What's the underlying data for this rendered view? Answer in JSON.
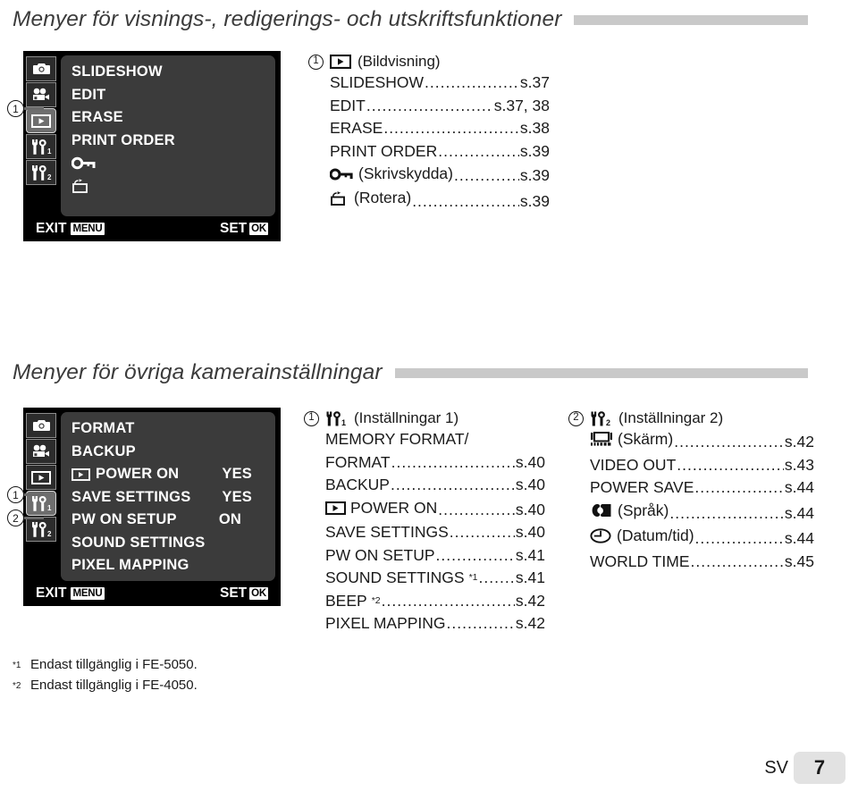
{
  "sections": [
    {
      "heading": "Menyer för visnings-, redigerings- och utskriftsfunktioner",
      "screen": {
        "tabs": [
          {
            "icon": "camera-icon",
            "selected": false
          },
          {
            "icon": "movie-icon",
            "selected": false
          },
          {
            "icon": "playback-icon",
            "selected": true
          },
          {
            "icon": "wrench-1-icon",
            "selected": false
          },
          {
            "icon": "wrench-2-icon",
            "selected": false
          }
        ],
        "rows": [
          {
            "label": "SLIDESHOW",
            "value": ""
          },
          {
            "label": "EDIT",
            "value": ""
          },
          {
            "label": "ERASE",
            "value": ""
          },
          {
            "label": "PRINT ORDER",
            "value": ""
          },
          {
            "label": "",
            "icon": "key-icon",
            "value": ""
          },
          {
            "label": "",
            "icon": "rotate-icon",
            "value": ""
          }
        ],
        "footer": {
          "exit_label": "EXIT",
          "exit_badge": "MENU",
          "set_label": "SET",
          "set_badge": "OK"
        }
      },
      "callouts": [
        {
          "number": "1"
        }
      ],
      "ref_columns": [
        {
          "number": "1",
          "icon": "playback-icon",
          "title": "(Bildvisning)",
          "lines": [
            {
              "name": "SLIDESHOW",
              "page": "s.37"
            },
            {
              "name": "EDIT",
              "page": "s.37, 38"
            },
            {
              "name": "ERASE",
              "page": "s.38"
            },
            {
              "name": "PRINT ORDER",
              "page": "s.39"
            },
            {
              "name": "(Skrivskydda)",
              "icon": "key-icon",
              "page": "s.39"
            },
            {
              "name": "(Rotera)",
              "icon": "rotate-icon",
              "page": "s.39"
            }
          ]
        }
      ]
    },
    {
      "heading": "Menyer för övriga kamerainställningar",
      "screen": {
        "tabs": [
          {
            "icon": "camera-icon",
            "selected": false
          },
          {
            "icon": "movie-icon",
            "selected": false
          },
          {
            "icon": "playback-icon",
            "selected": false
          },
          {
            "icon": "wrench-1-icon",
            "selected": true
          },
          {
            "icon": "wrench-2-icon",
            "selected": false
          }
        ],
        "rows": [
          {
            "label": "FORMAT",
            "value": ""
          },
          {
            "label": "BACKUP",
            "value": ""
          },
          {
            "label": "POWER ON",
            "icon": "playback-icon",
            "value": "YES"
          },
          {
            "label": "SAVE SETTINGS",
            "value": "YES"
          },
          {
            "label": "PW ON SETUP",
            "value": "ON"
          },
          {
            "label": "SOUND SETTINGS",
            "value": ""
          },
          {
            "label": "PIXEL MAPPING",
            "value": ""
          }
        ],
        "footer": {
          "exit_label": "EXIT",
          "exit_badge": "MENU",
          "set_label": "SET",
          "set_badge": "OK"
        }
      },
      "callouts": [
        {
          "number": "1"
        },
        {
          "number": "2"
        }
      ],
      "ref_columns": [
        {
          "number": "1",
          "icon": "wrench-1-icon",
          "title": "(Inställningar 1)",
          "lines": [
            {
              "name": "MEMORY FORMAT/",
              "page": "",
              "nopage": true
            },
            {
              "name": "FORMAT",
              "page": "s.40"
            },
            {
              "name": "BACKUP",
              "page": "s.40"
            },
            {
              "name": "POWER ON",
              "icon": "playback-icon",
              "page": "s.40"
            },
            {
              "name": "SAVE SETTINGS",
              "page": "s.40"
            },
            {
              "name": "PW ON SETUP",
              "page": "s.41"
            },
            {
              "name": "SOUND SETTINGS",
              "sup": "*1",
              "page": "s.41"
            },
            {
              "name": "BEEP",
              "sup": "*2",
              "page": "s.42"
            },
            {
              "name": "PIXEL MAPPING",
              "page": "s.42"
            }
          ]
        },
        {
          "number": "2",
          "icon": "wrench-2-icon",
          "title": "(Inställningar 2)",
          "lines": [
            {
              "name": "(Skärm)",
              "icon": "monitor-icon",
              "page": "s.42"
            },
            {
              "name": "VIDEO OUT",
              "page": "s.43"
            },
            {
              "name": "POWER SAVE",
              "page": "s.44"
            },
            {
              "name": "(Språk)",
              "icon": "language-icon",
              "page": "s.44"
            },
            {
              "name": "(Datum/tid)",
              "icon": "clock-icon",
              "page": "s.44"
            },
            {
              "name": "WORLD TIME",
              "page": "s.45"
            }
          ]
        }
      ]
    }
  ],
  "footnotes": [
    {
      "marker": "*1",
      "text": "Endast tillgänglig i FE-5050."
    },
    {
      "marker": "*2",
      "text": "Endast tillgänglig i FE-4050."
    }
  ],
  "page_footer": {
    "language": "SV",
    "page": "7"
  },
  "colors": {
    "rule": "#c9c9c9",
    "lcd_bg": "#000000",
    "menu_bg": "#3b3b3b",
    "tab_selected": "#6e6e6e"
  }
}
